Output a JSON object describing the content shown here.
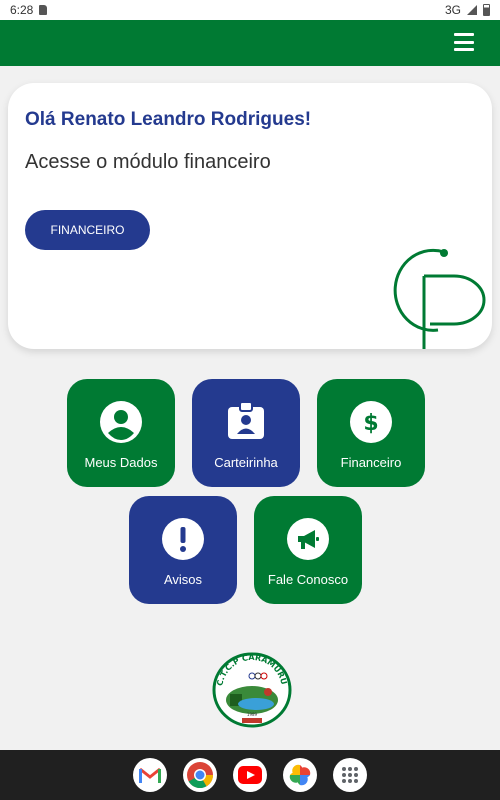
{
  "status_bar": {
    "time": "6:28",
    "network": "3G"
  },
  "card": {
    "greeting": "Olá Renato Leandro Rodrigues!",
    "subtitle": "Acesse o módulo financeiro",
    "button_label": "FINANCEIRO"
  },
  "tiles": [
    {
      "label": "Meus Dados",
      "icon": "person-icon",
      "color": "#007a33"
    },
    {
      "label": "Carteirinha",
      "icon": "id-badge-icon",
      "color": "#243a8f"
    },
    {
      "label": "Financeiro",
      "icon": "dollar-icon",
      "color": "#007a33"
    },
    {
      "label": "Avisos",
      "icon": "exclamation-icon",
      "color": "#243a8f"
    },
    {
      "label": "Fale Conosco",
      "icon": "megaphone-icon",
      "color": "#007a33"
    }
  ],
  "club_logo": {
    "name": "C.T.C.P CARAMURU",
    "year": "1989"
  },
  "dock": [
    "gmail",
    "chrome",
    "youtube",
    "photos",
    "app-drawer"
  ],
  "colors": {
    "primary_green": "#007a33",
    "primary_blue": "#243a8f"
  }
}
